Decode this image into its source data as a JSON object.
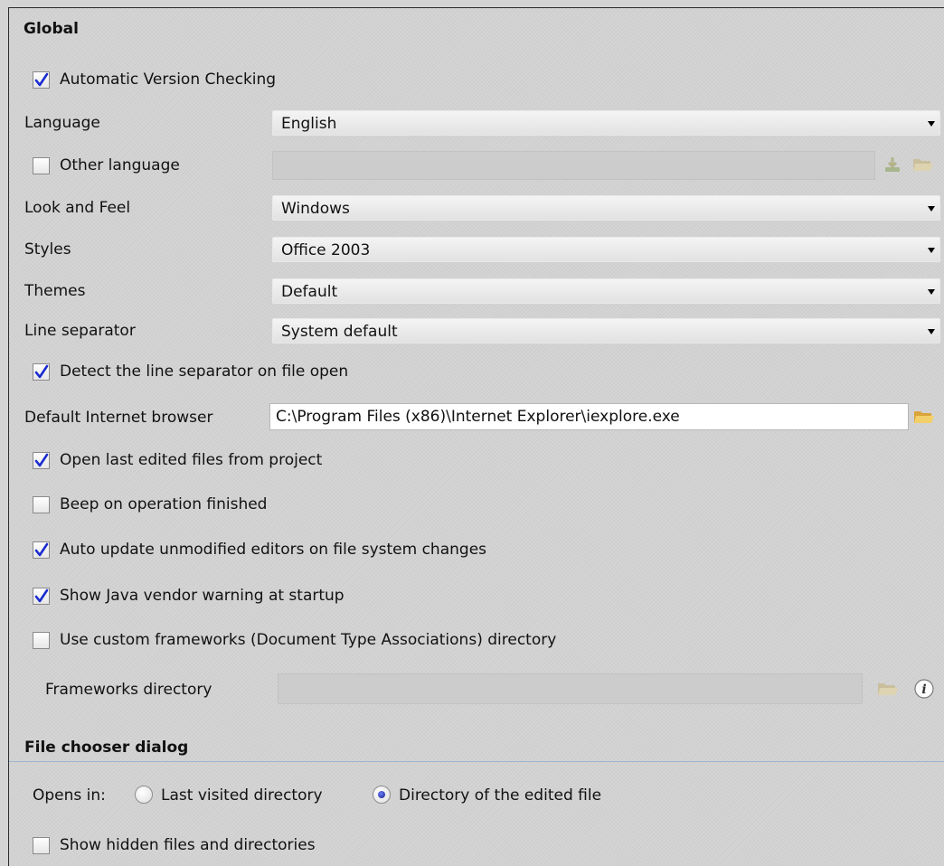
{
  "sections": {
    "global": "Global",
    "file_chooser": "File chooser dialog"
  },
  "checkboxes": {
    "auto_version": {
      "label": "Automatic Version Checking",
      "checked": true
    },
    "other_language": {
      "label": "Other language",
      "checked": false
    },
    "detect_separator": {
      "label": "Detect the line separator on file open",
      "checked": true
    },
    "open_last_edited": {
      "label": "Open last edited files from project",
      "checked": true
    },
    "beep": {
      "label": "Beep on operation finished",
      "checked": false
    },
    "auto_update": {
      "label": "Auto update unmodified editors on file system changes",
      "checked": true
    },
    "java_vendor": {
      "label": "Show Java vendor warning at startup",
      "checked": true
    },
    "custom_frameworks": {
      "label": "Use custom frameworks (Document Type Associations) directory",
      "checked": false
    },
    "hidden_files": {
      "label": "Show hidden files and directories",
      "checked": false
    }
  },
  "fields": {
    "language": {
      "label": "Language",
      "value": "English"
    },
    "look_and_feel": {
      "label": "Look and Feel",
      "value": "Windows"
    },
    "styles": {
      "label": "Styles",
      "value": "Office 2003"
    },
    "themes": {
      "label": "Themes",
      "value": "Default"
    },
    "line_separator": {
      "label": "Line separator",
      "value": "System default"
    },
    "browser": {
      "label": "Default Internet browser",
      "value": "C:\\Program Files (x86)\\Internet Explorer\\iexplore.exe"
    },
    "frameworks_dir": {
      "label": "Frameworks directory",
      "value": ""
    }
  },
  "opens_in": {
    "label": "Opens in:",
    "options": [
      {
        "label": "Last visited directory",
        "selected": false
      },
      {
        "label": "Directory of the edited file",
        "selected": true
      }
    ]
  },
  "icons": {
    "download": "download-icon",
    "folder": "folder-icon",
    "info": "info-icon"
  },
  "colors": {
    "check": "#1a2ccf",
    "radio_dot": "#13227a",
    "separator": "#9cb6cf"
  }
}
